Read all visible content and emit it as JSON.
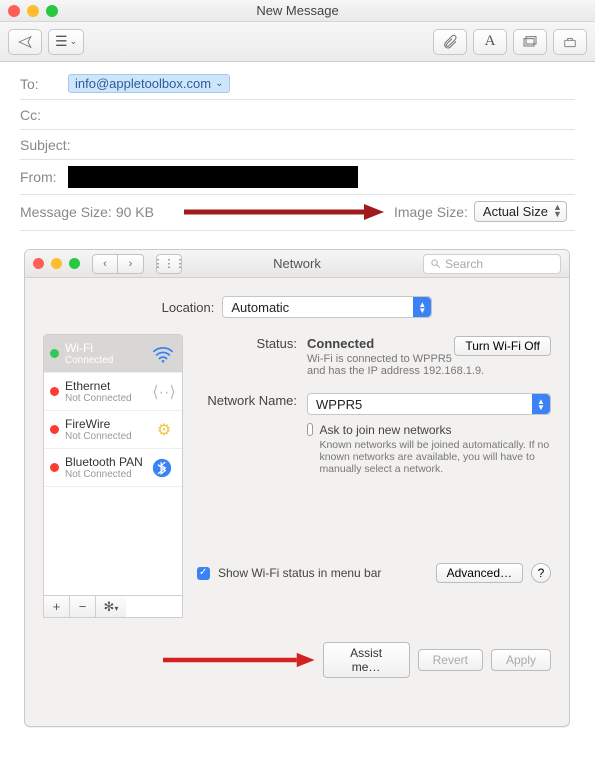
{
  "mail": {
    "title": "New Message",
    "to_label": "To:",
    "to_chip": "info@appletoolbox.com",
    "cc_label": "Cc:",
    "subject_label": "Subject:",
    "from_label": "From:",
    "message_size_label": "Message Size:",
    "message_size_value": "90 KB",
    "image_size_label": "Image Size:",
    "image_size_value": "Actual Size"
  },
  "network": {
    "title": "Network",
    "search_placeholder": "Search",
    "location_label": "Location:",
    "location_value": "Automatic",
    "sidebar_items": [
      {
        "name": "Wi-Fi",
        "sub": "Connected",
        "status": "green",
        "icon": "wifi",
        "selected": true
      },
      {
        "name": "Ethernet",
        "sub": "Not Connected",
        "status": "red",
        "icon": "ethernet"
      },
      {
        "name": "FireWire",
        "sub": "Not Connected",
        "status": "red",
        "icon": "firewire"
      },
      {
        "name": "Bluetooth PAN",
        "sub": "Not Connected",
        "status": "red",
        "icon": "bluetooth"
      }
    ],
    "status_label": "Status:",
    "status_value": "Connected",
    "turn_off_label": "Turn Wi-Fi Off",
    "status_subtext": "Wi-Fi is connected to WPPR5 and has the IP address 192.168.1.9.",
    "network_name_label": "Network Name:",
    "network_name_value": "WPPR5",
    "ask_join_label": "Ask to join new networks",
    "ask_join_sub": "Known networks will be joined automatically. If no known networks are available, you will have to manually select a network.",
    "show_menu_label": "Show Wi-Fi status in menu bar",
    "advanced_label": "Advanced…",
    "assist_label": "Assist me…",
    "revert_label": "Revert",
    "apply_label": "Apply"
  }
}
